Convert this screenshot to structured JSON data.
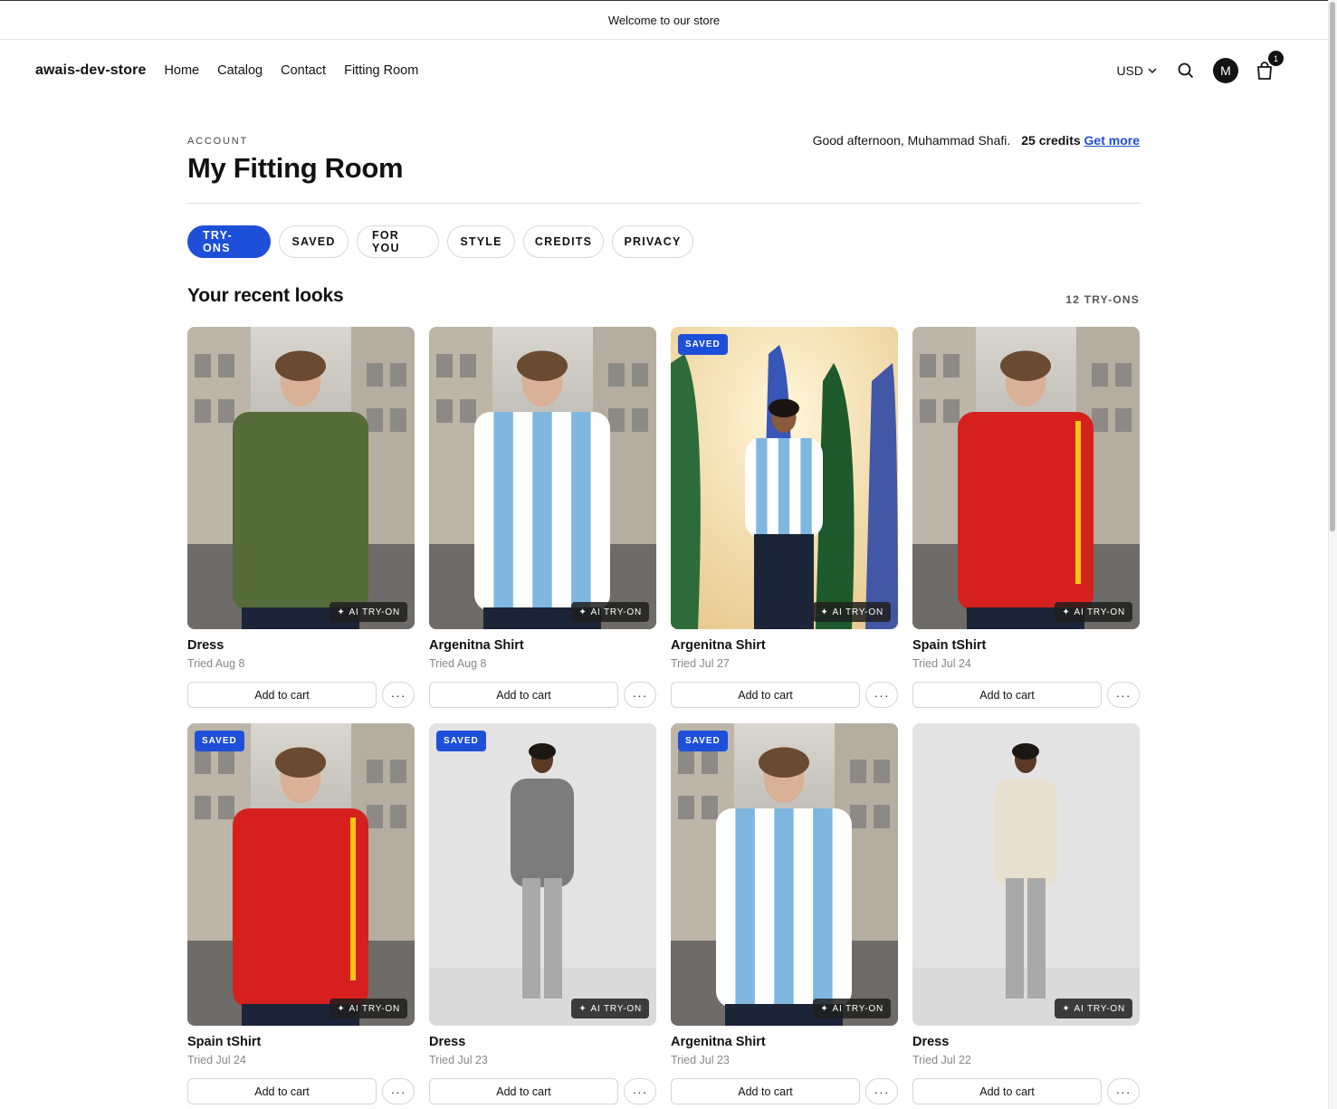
{
  "announcement": "Welcome to our store",
  "header": {
    "logo": "awais-dev-store",
    "nav": [
      "Home",
      "Catalog",
      "Contact",
      "Fitting Room"
    ],
    "currency": "USD",
    "avatar_initial": "M",
    "cart_count": "1"
  },
  "account": {
    "label": "ACCOUNT",
    "title": "My Fitting Room",
    "greeting": "Good afternoon, Muhammad Shafi.",
    "credits": "25 credits",
    "get_more": "Get more"
  },
  "tabs": [
    "TRY-ONS",
    "SAVED",
    "FOR YOU",
    "STYLE",
    "CREDITS",
    "PRIVACY"
  ],
  "active_tab": "TRY-ONS",
  "section": {
    "title": "Your recent looks",
    "count": "12 TRY-ONS"
  },
  "labels": {
    "ai_badge": "AI TRY-ON",
    "saved_badge": "SAVED",
    "add_to_cart": "Add to cart",
    "more": "···"
  },
  "looks": [
    {
      "name": "Dress",
      "date": "Tried Aug 8",
      "saved": false,
      "scene": "street",
      "garment": "green-puffer-jacket"
    },
    {
      "name": "Argenitna Shirt",
      "date": "Tried Aug 8",
      "saved": false,
      "scene": "street",
      "garment": "argentina-jersey"
    },
    {
      "name": "Argenitna Shirt",
      "date": "Tried Jul 27",
      "saved": true,
      "scene": "flags",
      "garment": "argentina-jersey"
    },
    {
      "name": "Spain tShirt",
      "date": "Tried Jul 24",
      "saved": false,
      "scene": "street",
      "garment": "spain-jersey"
    },
    {
      "name": "Spain tShirt",
      "date": "Tried Jul 24",
      "saved": true,
      "scene": "street",
      "garment": "spain-jersey"
    },
    {
      "name": "Dress",
      "date": "Tried Jul 23",
      "saved": true,
      "scene": "studio",
      "garment": "houndstooth-blazer"
    },
    {
      "name": "Argenitna Shirt",
      "date": "Tried Jul 23",
      "saved": true,
      "scene": "street",
      "garment": "argentina-jersey"
    },
    {
      "name": "Dress",
      "date": "Tried Jul 22",
      "saved": false,
      "scene": "studio",
      "garment": "cream-cable-sweater"
    }
  ]
}
